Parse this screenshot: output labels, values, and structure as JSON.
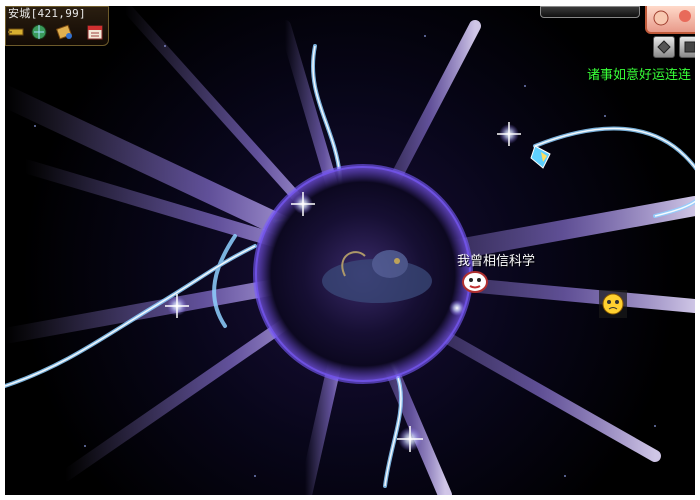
{
  "location": {
    "text": "安城[421,99]"
  },
  "scroll_message": "诸事如意好运连连",
  "player": {
    "name": "我曾相信科学"
  },
  "icons": {
    "top_left": [
      "sword-icon",
      "globe-icon",
      "scroll-icon",
      "calendar-icon"
    ],
    "top_right": [
      "gem-button-icon",
      "cube-button-icon"
    ]
  },
  "colors": {
    "message_green": "#38ff38",
    "vortex_purple": "#8a6cff",
    "lightning_blue": "#8fd0ff"
  }
}
